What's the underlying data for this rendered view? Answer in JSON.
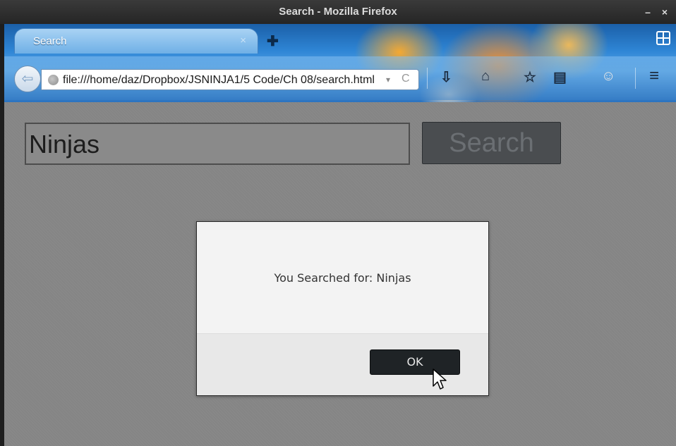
{
  "window": {
    "title": "Search - Mozilla Firefox",
    "controls": "– ×"
  },
  "tabs": [
    {
      "label": "Search",
      "close": "×"
    }
  ],
  "toolbar": {
    "new_tab_glyph": "✚",
    "url": "file:///home/daz/Dropbox/JSNINJA1/5 Code/Ch 08/search.html",
    "url_dropdown": "▾",
    "reload_glyph": "C",
    "icons": [
      "download-icon",
      "home-icon",
      "bookmark-star-icon",
      "reader-icon",
      "ghostery-icon",
      "menu-icon"
    ],
    "download_glyph": "⇩",
    "home_glyph": "⌂",
    "bookmark_glyph": "☆",
    "reader_glyph": "▤",
    "menu_glyph": "≡"
  },
  "page": {
    "search_value": "Ninjas",
    "search_button": "Search"
  },
  "dialog": {
    "message": "You Searched for: Ninjas",
    "ok_label": "OK"
  },
  "colors": {
    "page_bg": "#858585",
    "search_button_bg": "#4a4d50",
    "ok_button_bg": "#1f2326",
    "dialog_bg": "#f3f3f3"
  }
}
